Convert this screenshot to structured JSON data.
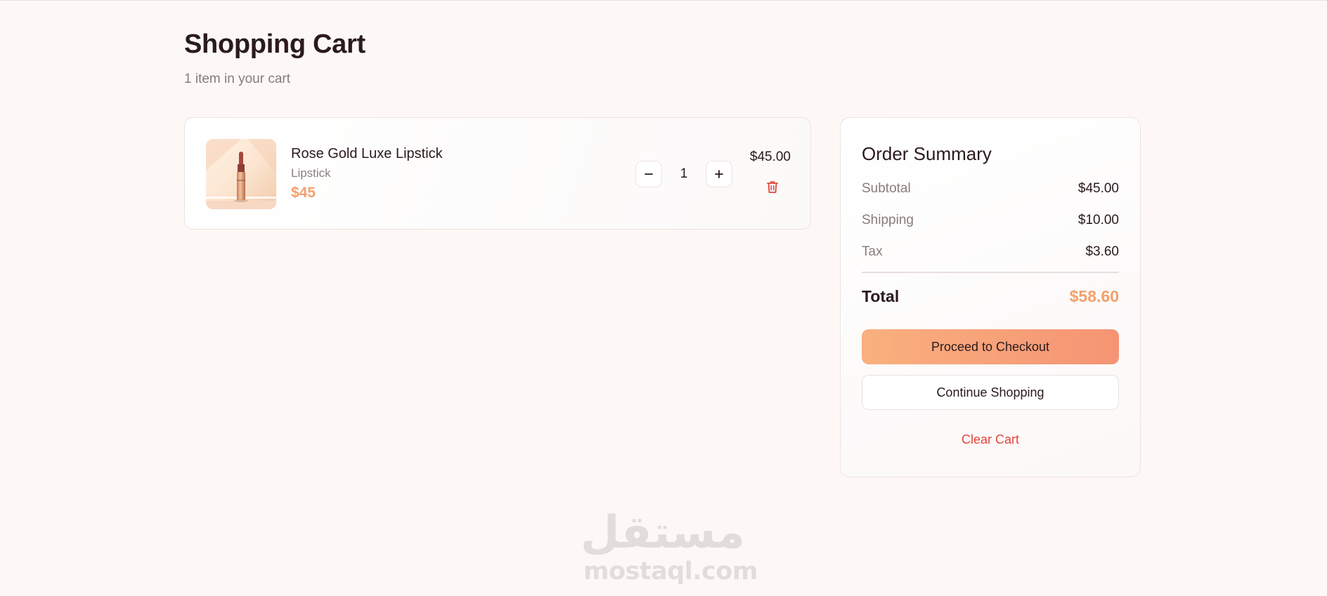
{
  "page": {
    "title": "Shopping Cart",
    "subtitle": "1 item in your cart"
  },
  "cart": {
    "items": [
      {
        "name": "Rose Gold Luxe Lipstick",
        "category": "Lipstick",
        "price": "$45",
        "quantity": "1",
        "line_total": "$45.00",
        "image_icon": "lipstick-product-photo",
        "minus_icon": "minus-icon",
        "plus_icon": "plus-icon",
        "delete_icon": "trash-icon"
      }
    ]
  },
  "summary": {
    "title": "Order Summary",
    "subtotal_label": "Subtotal",
    "subtotal_value": "$45.00",
    "shipping_label": "Shipping",
    "shipping_value": "$10.00",
    "tax_label": "Tax",
    "tax_value": "$3.60",
    "total_label": "Total",
    "total_value": "$58.60",
    "checkout_label": "Proceed to Checkout",
    "continue_label": "Continue Shopping",
    "clear_label": "Clear Cart"
  },
  "watermark": {
    "text": "mostaql.com",
    "arabic_text": "مستقل"
  },
  "colors": {
    "background": "#fdf8f6",
    "accent": "#f4a06c",
    "danger": "#e0453c",
    "text": "#2a1a1c",
    "muted": "#8a7c7c"
  }
}
